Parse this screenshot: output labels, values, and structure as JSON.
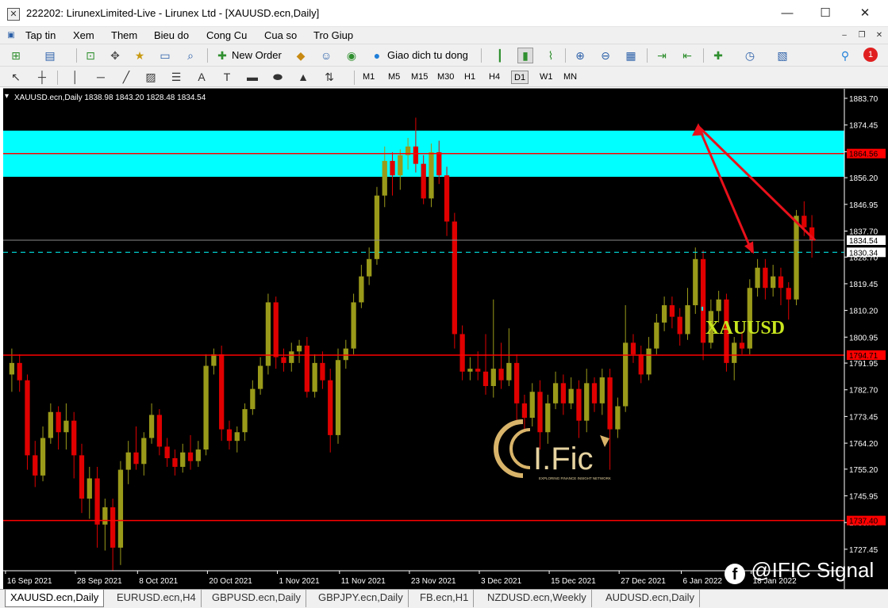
{
  "window": {
    "title": "222202: LirunexLimited-Live - Lirunex Ltd - [XAUUSD.ecn,Daily]",
    "minimize": "—",
    "maximize": "☐",
    "close": "✕"
  },
  "menu": {
    "items": [
      "Tap tin",
      "Xem",
      "Them",
      "Bieu do",
      "Cong Cu",
      "Cua so",
      "Tro Giup"
    ]
  },
  "toolbar": {
    "new_order": "New Order",
    "auto_trading": "Giao dich tu dong",
    "notification_count": "1"
  },
  "timeframes": [
    "M1",
    "M5",
    "M15",
    "M30",
    "H1",
    "H4",
    "D1",
    "W1",
    "MN"
  ],
  "active_timeframe": "D1",
  "chart": {
    "info": "XAUUSD.ecn,Daily  1838.98 1843.20 1828.48 1834.54",
    "symbol_label": "XAUUSD",
    "logo_text": "I.Fic",
    "logo_tagline": "EXPLORING FINANCE INSIGHT NETWORK",
    "price_axis": [
      "1883.70",
      "1874.45",
      "1865.20",
      "1856.20",
      "1846.95",
      "1837.70",
      "1828.70",
      "1819.45",
      "1810.20",
      "1800.95",
      "1791.95",
      "1782.70",
      "1773.45",
      "1764.20",
      "1755.20",
      "1745.95",
      "1736.70",
      "1727.45"
    ],
    "date_axis": [
      "16 Sep 2021",
      "28 Sep 2021",
      "8 Oct 2021",
      "20 Oct 2021",
      "1 Nov 2021",
      "11 Nov 2021",
      "23 Nov 2021",
      "3 Dec 2021",
      "15 Dec 2021",
      "27 Dec 2021",
      "6 Jan 2022",
      "18 Jan 2022"
    ],
    "price_tags": {
      "resistance_top": "1864.56",
      "current": "1834.54",
      "dashed": "1830.34",
      "support_mid": "1794.71",
      "support_low": "1737.40"
    },
    "colors": {
      "bull": "#9a9a1a",
      "bear": "#e00000",
      "zone": "#00ffff",
      "level": "#ff0000",
      "arrow": "#e8101a",
      "symbol_text": "#c8e61e"
    }
  },
  "chart_data": {
    "type": "candlestick",
    "title": "XAUUSD.ecn,Daily",
    "ylim": [
      1720.0,
      1887.0
    ],
    "candles": [
      {
        "o": 1788,
        "c": 1792,
        "h": 1797,
        "l": 1782
      },
      {
        "o": 1792,
        "c": 1786,
        "h": 1795,
        "l": 1782
      },
      {
        "o": 1786,
        "c": 1760,
        "h": 1788,
        "l": 1755
      },
      {
        "o": 1760,
        "c": 1753,
        "h": 1765,
        "l": 1749
      },
      {
        "o": 1753,
        "c": 1766,
        "h": 1770,
        "l": 1751
      },
      {
        "o": 1766,
        "c": 1775,
        "h": 1778,
        "l": 1764
      },
      {
        "o": 1775,
        "c": 1768,
        "h": 1777,
        "l": 1762
      },
      {
        "o": 1768,
        "c": 1772,
        "h": 1778,
        "l": 1762
      },
      {
        "o": 1772,
        "c": 1760,
        "h": 1775,
        "l": 1752
      },
      {
        "o": 1760,
        "c": 1745,
        "h": 1764,
        "l": 1740
      },
      {
        "o": 1745,
        "c": 1752,
        "h": 1756,
        "l": 1738
      },
      {
        "o": 1752,
        "c": 1736,
        "h": 1756,
        "l": 1728
      },
      {
        "o": 1736,
        "c": 1742,
        "h": 1745,
        "l": 1727
      },
      {
        "o": 1742,
        "c": 1728,
        "h": 1745,
        "l": 1720
      },
      {
        "o": 1728,
        "c": 1755,
        "h": 1758,
        "l": 1722
      },
      {
        "o": 1755,
        "c": 1761,
        "h": 1765,
        "l": 1750
      },
      {
        "o": 1761,
        "c": 1757,
        "h": 1770,
        "l": 1755
      },
      {
        "o": 1757,
        "c": 1766,
        "h": 1768,
        "l": 1753
      },
      {
        "o": 1766,
        "c": 1774,
        "h": 1778,
        "l": 1764
      },
      {
        "o": 1774,
        "c": 1763,
        "h": 1776,
        "l": 1760
      },
      {
        "o": 1763,
        "c": 1759,
        "h": 1766,
        "l": 1756
      },
      {
        "o": 1759,
        "c": 1756,
        "h": 1762,
        "l": 1753
      },
      {
        "o": 1756,
        "c": 1761,
        "h": 1764,
        "l": 1754
      },
      {
        "o": 1761,
        "c": 1758,
        "h": 1767,
        "l": 1755
      },
      {
        "o": 1758,
        "c": 1762,
        "h": 1765,
        "l": 1756
      },
      {
        "o": 1762,
        "c": 1791,
        "h": 1795,
        "l": 1760
      },
      {
        "o": 1791,
        "c": 1795,
        "h": 1797,
        "l": 1788
      },
      {
        "o": 1795,
        "c": 1769,
        "h": 1798,
        "l": 1765
      },
      {
        "o": 1769,
        "c": 1765,
        "h": 1772,
        "l": 1762
      },
      {
        "o": 1765,
        "c": 1768,
        "h": 1770,
        "l": 1761
      },
      {
        "o": 1768,
        "c": 1776,
        "h": 1778,
        "l": 1765
      },
      {
        "o": 1776,
        "c": 1783,
        "h": 1786,
        "l": 1774
      },
      {
        "o": 1783,
        "c": 1791,
        "h": 1794,
        "l": 1781
      },
      {
        "o": 1791,
        "c": 1813,
        "h": 1816,
        "l": 1788
      },
      {
        "o": 1813,
        "c": 1794,
        "h": 1815,
        "l": 1790
      },
      {
        "o": 1794,
        "c": 1792,
        "h": 1797,
        "l": 1789
      },
      {
        "o": 1792,
        "c": 1796,
        "h": 1799,
        "l": 1789
      },
      {
        "o": 1796,
        "c": 1798,
        "h": 1800,
        "l": 1792
      },
      {
        "o": 1798,
        "c": 1782,
        "h": 1801,
        "l": 1780
      },
      {
        "o": 1782,
        "c": 1792,
        "h": 1795,
        "l": 1780
      },
      {
        "o": 1792,
        "c": 1786,
        "h": 1796,
        "l": 1783
      },
      {
        "o": 1786,
        "c": 1767,
        "h": 1790,
        "l": 1761
      },
      {
        "o": 1767,
        "c": 1793,
        "h": 1797,
        "l": 1764
      },
      {
        "o": 1793,
        "c": 1797,
        "h": 1800,
        "l": 1790
      },
      {
        "o": 1797,
        "c": 1813,
        "h": 1816,
        "l": 1795
      },
      {
        "o": 1813,
        "c": 1822,
        "h": 1826,
        "l": 1811
      },
      {
        "o": 1822,
        "c": 1828,
        "h": 1832,
        "l": 1819
      },
      {
        "o": 1828,
        "c": 1850,
        "h": 1853,
        "l": 1826
      },
      {
        "o": 1850,
        "c": 1862,
        "h": 1867,
        "l": 1846
      },
      {
        "o": 1862,
        "c": 1857,
        "h": 1865,
        "l": 1850
      },
      {
        "o": 1857,
        "c": 1864,
        "h": 1866,
        "l": 1852
      },
      {
        "o": 1864,
        "c": 1867,
        "h": 1870,
        "l": 1859
      },
      {
        "o": 1867,
        "c": 1861,
        "h": 1877,
        "l": 1858
      },
      {
        "o": 1861,
        "c": 1849,
        "h": 1864,
        "l": 1847
      },
      {
        "o": 1849,
        "c": 1865,
        "h": 1868,
        "l": 1846
      },
      {
        "o": 1865,
        "c": 1857,
        "h": 1869,
        "l": 1854
      },
      {
        "o": 1857,
        "c": 1841,
        "h": 1860,
        "l": 1836
      },
      {
        "o": 1841,
        "c": 1802,
        "h": 1844,
        "l": 1797
      },
      {
        "o": 1802,
        "c": 1789,
        "h": 1805,
        "l": 1786
      },
      {
        "o": 1789,
        "c": 1790,
        "h": 1794,
        "l": 1786
      },
      {
        "o": 1790,
        "c": 1789,
        "h": 1796,
        "l": 1786
      },
      {
        "o": 1789,
        "c": 1784,
        "h": 1802,
        "l": 1781
      },
      {
        "o": 1784,
        "c": 1790,
        "h": 1814,
        "l": 1780
      },
      {
        "o": 1790,
        "c": 1786,
        "h": 1799,
        "l": 1783
      },
      {
        "o": 1786,
        "c": 1792,
        "h": 1804,
        "l": 1784
      },
      {
        "o": 1792,
        "c": 1778,
        "h": 1795,
        "l": 1772
      },
      {
        "o": 1778,
        "c": 1773,
        "h": 1781,
        "l": 1768
      },
      {
        "o": 1773,
        "c": 1782,
        "h": 1785,
        "l": 1770
      },
      {
        "o": 1782,
        "c": 1768,
        "h": 1786,
        "l": 1762
      },
      {
        "o": 1768,
        "c": 1778,
        "h": 1781,
        "l": 1764
      },
      {
        "o": 1778,
        "c": 1785,
        "h": 1789,
        "l": 1776
      },
      {
        "o": 1785,
        "c": 1778,
        "h": 1788,
        "l": 1774
      },
      {
        "o": 1778,
        "c": 1783,
        "h": 1787,
        "l": 1776
      },
      {
        "o": 1783,
        "c": 1772,
        "h": 1786,
        "l": 1766
      },
      {
        "o": 1772,
        "c": 1785,
        "h": 1790,
        "l": 1768
      },
      {
        "o": 1785,
        "c": 1778,
        "h": 1787,
        "l": 1775
      },
      {
        "o": 1778,
        "c": 1787,
        "h": 1790,
        "l": 1774
      },
      {
        "o": 1787,
        "c": 1769,
        "h": 1790,
        "l": 1755
      },
      {
        "o": 1769,
        "c": 1777,
        "h": 1780,
        "l": 1766
      },
      {
        "o": 1777,
        "c": 1799,
        "h": 1812,
        "l": 1775
      },
      {
        "o": 1799,
        "c": 1795,
        "h": 1802,
        "l": 1792
      },
      {
        "o": 1795,
        "c": 1788,
        "h": 1798,
        "l": 1785
      },
      {
        "o": 1788,
        "c": 1797,
        "h": 1801,
        "l": 1786
      },
      {
        "o": 1797,
        "c": 1806,
        "h": 1809,
        "l": 1795
      },
      {
        "o": 1806,
        "c": 1812,
        "h": 1815,
        "l": 1803
      },
      {
        "o": 1812,
        "c": 1808,
        "h": 1815,
        "l": 1804
      },
      {
        "o": 1808,
        "c": 1802,
        "h": 1811,
        "l": 1798
      },
      {
        "o": 1802,
        "c": 1812,
        "h": 1818,
        "l": 1800
      },
      {
        "o": 1812,
        "c": 1828,
        "h": 1832,
        "l": 1809
      },
      {
        "o": 1828,
        "c": 1799,
        "h": 1831,
        "l": 1793
      },
      {
        "o": 1799,
        "c": 1810,
        "h": 1814,
        "l": 1797
      },
      {
        "o": 1810,
        "c": 1814,
        "h": 1817,
        "l": 1806
      },
      {
        "o": 1814,
        "c": 1792,
        "h": 1816,
        "l": 1789
      },
      {
        "o": 1792,
        "c": 1799,
        "h": 1801,
        "l": 1786
      },
      {
        "o": 1799,
        "c": 1797,
        "h": 1803,
        "l": 1795
      },
      {
        "o": 1797,
        "c": 1818,
        "h": 1821,
        "l": 1795
      },
      {
        "o": 1818,
        "c": 1825,
        "h": 1828,
        "l": 1815
      },
      {
        "o": 1825,
        "c": 1818,
        "h": 1828,
        "l": 1814
      },
      {
        "o": 1818,
        "c": 1822,
        "h": 1826,
        "l": 1815
      },
      {
        "o": 1822,
        "c": 1818,
        "h": 1825,
        "l": 1812
      },
      {
        "o": 1818,
        "c": 1814,
        "h": 1820,
        "l": 1807
      },
      {
        "o": 1814,
        "c": 1843,
        "h": 1845,
        "l": 1812
      },
      {
        "o": 1843,
        "c": 1839,
        "h": 1848,
        "l": 1836
      },
      {
        "o": 1838.98,
        "c": 1834.54,
        "h": 1843.2,
        "l": 1828.48
      }
    ],
    "levels": [
      1864.56,
      1830.34,
      1794.71,
      1737.4
    ],
    "zone": [
      1856.5,
      1872.5
    ],
    "projection": [
      [
        1834.5,
        1874.0
      ],
      [
        1874.0,
        1830.3
      ]
    ]
  },
  "tabs": [
    "XAUUSD.ecn,Daily",
    "EURUSD.ecn,H4",
    "GBPUSD.ecn,Daily",
    "GBPJPY.ecn,Daily",
    "FB.ecn,H1",
    "NZDUSD.ecn,Weekly",
    "AUDUSD.ecn,Daily"
  ],
  "watermark": "@IFIC Signal"
}
